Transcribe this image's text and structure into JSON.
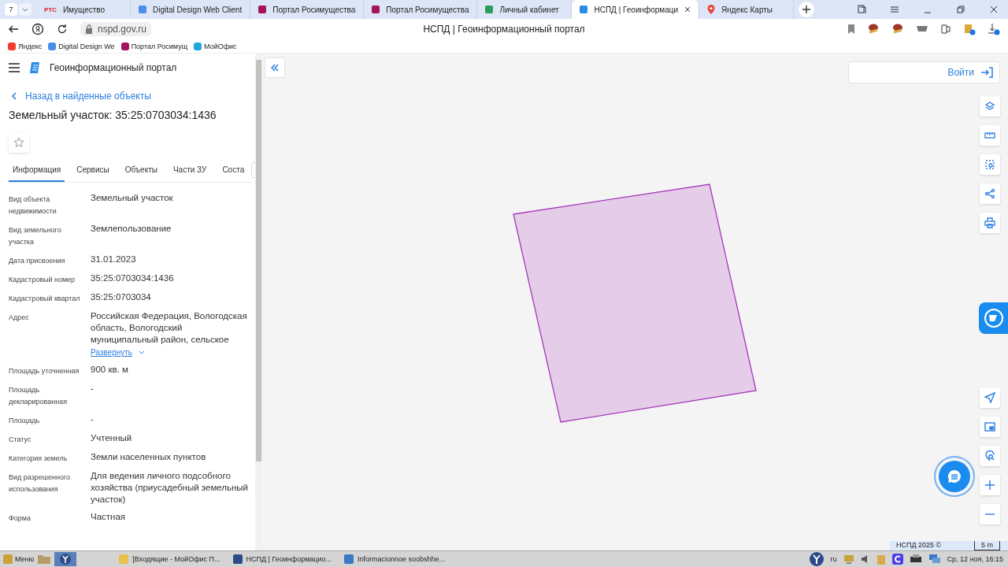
{
  "browser": {
    "tab_counter": "7",
    "tabs": [
      {
        "label": "Имущество",
        "icon_text": "РТС",
        "selected": false
      },
      {
        "label": "Digital Design Web Client",
        "selected": false
      },
      {
        "label": "Портал Росимущества",
        "selected": false
      },
      {
        "label": "Портал Росимущества",
        "selected": false
      },
      {
        "label": "Личный кабинет",
        "selected": false
      },
      {
        "label": "НСПД | Геоинформаци",
        "selected": true
      },
      {
        "label": "Яндекс Карты",
        "selected": false
      }
    ],
    "address": "nspd.gov.ru",
    "page_title": "НСПД | Геоинформационный портал",
    "bookmarks": [
      "Яндекс",
      "Digital Design We",
      "Портал Росимущ",
      "МойОфис"
    ]
  },
  "panel": {
    "app_title": "Геоинформационный портал",
    "back_link": "Назад в найденные объекты",
    "heading": "Земельный участок: 35:25:0703034:1436",
    "tabs": [
      {
        "label": "Информация",
        "selected": true
      },
      {
        "label": "Сервисы",
        "selected": false
      },
      {
        "label": "Объекты",
        "selected": false
      },
      {
        "label": "Части ЗУ",
        "selected": false
      },
      {
        "label": "Соста",
        "selected": false
      }
    ],
    "fields": [
      {
        "label": "Вид объекта недвижимости",
        "value": "Земельный участок"
      },
      {
        "label": "Вид земельного участка",
        "value": "Землепользование"
      },
      {
        "label": "Дата присвоения",
        "value": "31.01.2023"
      },
      {
        "label": "Кадастровый номер",
        "value": "35:25:0703034:1436"
      },
      {
        "label": "Кадастровый квартал",
        "value": "35:25:0703034"
      },
      {
        "label": "Адрес",
        "value": "Российская Федерация, Вологодская область, Вологодский муниципальный район, сельское",
        "expand_link": "Развернуть"
      },
      {
        "label": "Площадь уточненная",
        "value": "900 кв. м"
      },
      {
        "label": "Площадь декларированная",
        "value": "-"
      },
      {
        "label": "Площадь",
        "value": "-"
      },
      {
        "label": "Статус",
        "value": "Учтенный"
      },
      {
        "label": "Категория земель",
        "value": "Земли населенных пунктов"
      },
      {
        "label": "Вид разрешенного использования",
        "value": "Для ведения личного подсобного хозяйства (приусадебный земельный участок)"
      },
      {
        "label": "Форма",
        "value": "Частная"
      }
    ]
  },
  "map": {
    "login_button": "Войти",
    "top_tools": [
      {
        "kind": "layers"
      },
      {
        "kind": "ruler"
      },
      {
        "kind": "select"
      },
      {
        "kind": "share"
      },
      {
        "kind": "print"
      }
    ],
    "bottom_tools": [
      {
        "kind": "locate"
      },
      {
        "kind": "minimap"
      },
      {
        "kind": "geosearch"
      },
      {
        "kind": "zoom-in"
      },
      {
        "kind": "zoom-out"
      }
    ],
    "attribution": "НСПД 2025 ©",
    "scale": "5 m"
  },
  "taskbar": {
    "menu": "Меню",
    "tasks": [
      "[Входящие - МойОфис П...",
      "НСПД | Геоинформацио...",
      "Informacionnoe soobshhe..."
    ],
    "language": "ru",
    "clock": "Ср, 12 ноя, 16:15"
  }
}
